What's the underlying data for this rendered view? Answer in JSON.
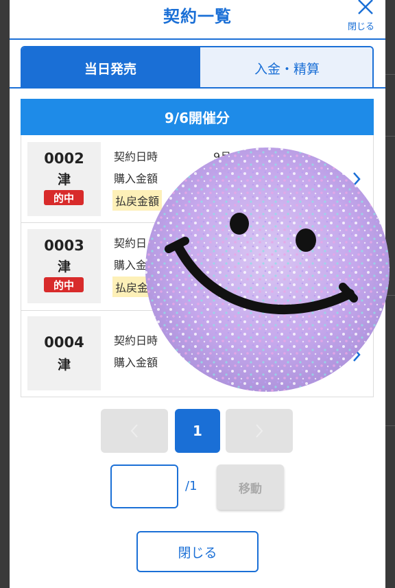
{
  "header": {
    "title": "契約一覧",
    "close_label": "閉じる"
  },
  "tabs": [
    {
      "label": "当日発売",
      "active": true
    },
    {
      "label": "入金・精算",
      "active": false
    }
  ],
  "section": {
    "title": "9/6開催分"
  },
  "rows": [
    {
      "number": "0002",
      "venue": "津",
      "badge": "的中",
      "contract_label": "契約日時",
      "contract_value": "9月6日  時40分",
      "purchase_label": "購入金額",
      "refund_label": "払戻金額"
    },
    {
      "number": "0003",
      "venue": "津",
      "badge": "的中",
      "contract_label": "契約日",
      "purchase_label": "購入金",
      "refund_label": "払戻金"
    },
    {
      "number": "0004",
      "venue": "津",
      "badge": "",
      "contract_label": "契約日時",
      "purchase_label": "購入金額"
    }
  ],
  "pagination": {
    "current_page": "1",
    "total": "/1",
    "move_label": "移動",
    "input_value": ""
  },
  "footer": {
    "close_label": "閉じる"
  },
  "colors": {
    "accent": "#1a6fd6",
    "section_bar": "#1e8be8",
    "badge": "#d82b2b",
    "highlight": "#fdf0b8"
  },
  "icons": {
    "close": "close-x-icon",
    "row_arrow": "chevron-right-icon",
    "sticker": "smiley-glitter-sticker"
  }
}
